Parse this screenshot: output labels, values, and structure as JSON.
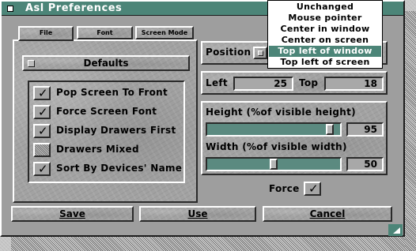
{
  "window": {
    "title": "Asl Preferences"
  },
  "tabs": [
    {
      "label": "File",
      "active": true
    },
    {
      "label": "Font",
      "active": false
    },
    {
      "label": "Screen Mode",
      "active": false
    }
  ],
  "defaults_cycle": {
    "value": "Defaults"
  },
  "checkboxes": [
    {
      "label": "Pop Screen To Front",
      "checked": true
    },
    {
      "label": "Force Screen Font",
      "checked": true
    },
    {
      "label": "Display Drawers First",
      "checked": true
    },
    {
      "label": "Drawers Mixed",
      "checked": false
    },
    {
      "label": "Sort By Devices' Name",
      "checked": true
    }
  ],
  "position": {
    "label": "Position",
    "options": [
      "Unchanged",
      "Mouse pointer",
      "Center in window",
      "Center on screen",
      "Top left of window",
      "Top left of screen"
    ],
    "selected": "Top left of window"
  },
  "left": {
    "label": "Left",
    "value": "25"
  },
  "top": {
    "label": "Top",
    "value": "18"
  },
  "height": {
    "label": "Height (%of visible height)",
    "value": "95"
  },
  "width": {
    "label": "Width (%of visible width)",
    "value": "50"
  },
  "force": {
    "label": "Force",
    "checked": true
  },
  "buttons": {
    "save": "Save",
    "use": "Use",
    "cancel": "Cancel"
  },
  "colors": {
    "titlebar": "#4c8578",
    "slider_track": "#5b8a80",
    "selection": "#4c8578"
  }
}
